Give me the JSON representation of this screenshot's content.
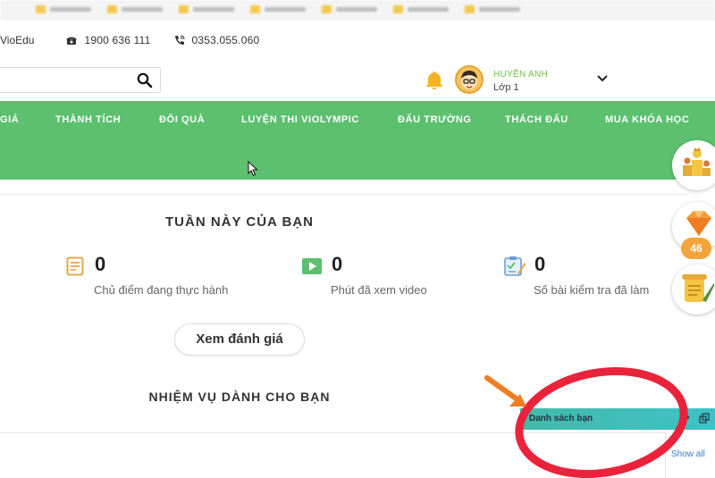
{
  "brand": "VioEdu",
  "contact": {
    "phone1": "1900 636 111",
    "phone2": "0353.055.060"
  },
  "search": {
    "placeholder": ""
  },
  "user": {
    "name": "HUYỀN ANH",
    "class": "Lớp 1"
  },
  "nav": {
    "items": [
      "GIÁ",
      "THÀNH TÍCH",
      "ĐỔI QUÀ",
      "LUYỆN THI VIOLYMPIC",
      "ĐẤU TRƯỜNG",
      "THÁCH ĐẤU",
      "MUA KHÓA HỌC"
    ]
  },
  "week": {
    "title": "TUẦN NÀY CỦA BẠN",
    "stats": [
      {
        "value": "0",
        "label": "Chủ điểm đang thực hành",
        "icon": "document-list-icon",
        "color": "#e8a54b"
      },
      {
        "value": "0",
        "label": "Phút đã xem video",
        "icon": "video-play-icon",
        "color": "#5cc06f"
      },
      {
        "value": "0",
        "label": "Số bài kiểm tra đã làm",
        "icon": "test-clipboard-icon",
        "color": "#6a9fd6"
      }
    ],
    "review_button": "Xem đánh giá"
  },
  "missions": {
    "title": "NHIỆM VỤ DÀNH CHO BẠN"
  },
  "side": {
    "diamond_count": "46"
  },
  "friends": {
    "title": "Danh sách bạn",
    "show_all": "Show all"
  },
  "colors": {
    "nav_green": "#5cc06f",
    "annotation_red": "#e8233b",
    "annotation_orange": "#ee7d23",
    "friends_teal": "#3ec2c7"
  }
}
